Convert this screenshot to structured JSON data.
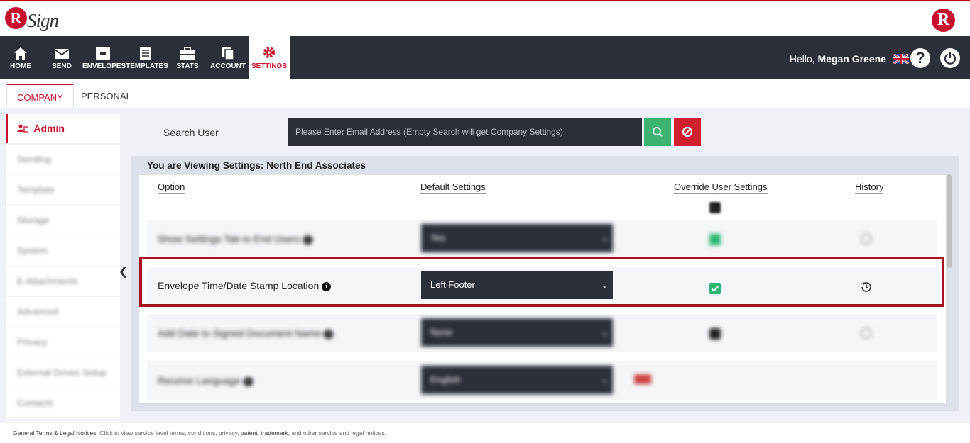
{
  "brand": {
    "logo_letter": "R",
    "logo_text": "Sign",
    "right_logo_letter": "R"
  },
  "nav": {
    "items": [
      {
        "label": "HOME",
        "icon": "home-icon"
      },
      {
        "label": "SEND",
        "icon": "envelope-icon"
      },
      {
        "label": "ENVELOPES",
        "icon": "inbox-icon"
      },
      {
        "label": "TEMPLATES",
        "icon": "document-icon"
      },
      {
        "label": "STATS",
        "icon": "briefcase-icon"
      },
      {
        "label": "ACCOUNT",
        "icon": "copy-icon"
      },
      {
        "label": "SETTINGS",
        "icon": "gear-icon"
      }
    ],
    "active": "SETTINGS",
    "hello": "Hello,",
    "user_name": "Megan Greene",
    "help_label": "?"
  },
  "tabs": [
    {
      "label": "COMPANY",
      "active": true
    },
    {
      "label": "PERSONAL",
      "active": false
    }
  ],
  "sidebar": {
    "items": [
      {
        "label": "Admin",
        "active": true,
        "blurred": false
      },
      {
        "label": "Sending",
        "blurred": true
      },
      {
        "label": "Template",
        "blurred": true
      },
      {
        "label": "Storage",
        "blurred": true
      },
      {
        "label": "System",
        "blurred": true
      },
      {
        "label": "E-Attachments",
        "blurred": true
      },
      {
        "label": "Advanced",
        "blurred": true
      },
      {
        "label": "Privacy",
        "blurred": true
      },
      {
        "label": "External Drives Setup",
        "blurred": true
      },
      {
        "label": "Contacts",
        "blurred": true
      }
    ]
  },
  "search": {
    "label": "Search User",
    "placeholder": "Please Enter Email Address (Empty Search will get Company Settings)"
  },
  "panel": {
    "title": "You are Viewing Settings: North End Associates",
    "columns": {
      "option": "Option",
      "default": "Default Settings",
      "override": "Override User Settings",
      "history": "History"
    },
    "rows": [
      {
        "option": "Show Settings Tab to End Users",
        "value": "Yes",
        "blurred": true
      },
      {
        "option": "Envelope Time/Date Stamp Location",
        "value": "Left Footer",
        "blurred": false,
        "override_checked": true
      },
      {
        "option": "Add Date to Signed Document Name",
        "value": "None",
        "blurred": true
      },
      {
        "option": "Receive Language",
        "value": "English",
        "blurred": true
      }
    ]
  },
  "footer": {
    "lead": "General Terms & Legal Notices:",
    "text": " Click to view service level terms, conditions, privacy, ",
    "patent": "patent",
    "sep": ", ",
    "trademark": "trademark",
    "tail": ", and other service and legal notices."
  },
  "colors": {
    "accent": "#c8102e",
    "nav_bg": "#2b2f38",
    "success": "#3cb371",
    "danger": "#d11f2f"
  }
}
